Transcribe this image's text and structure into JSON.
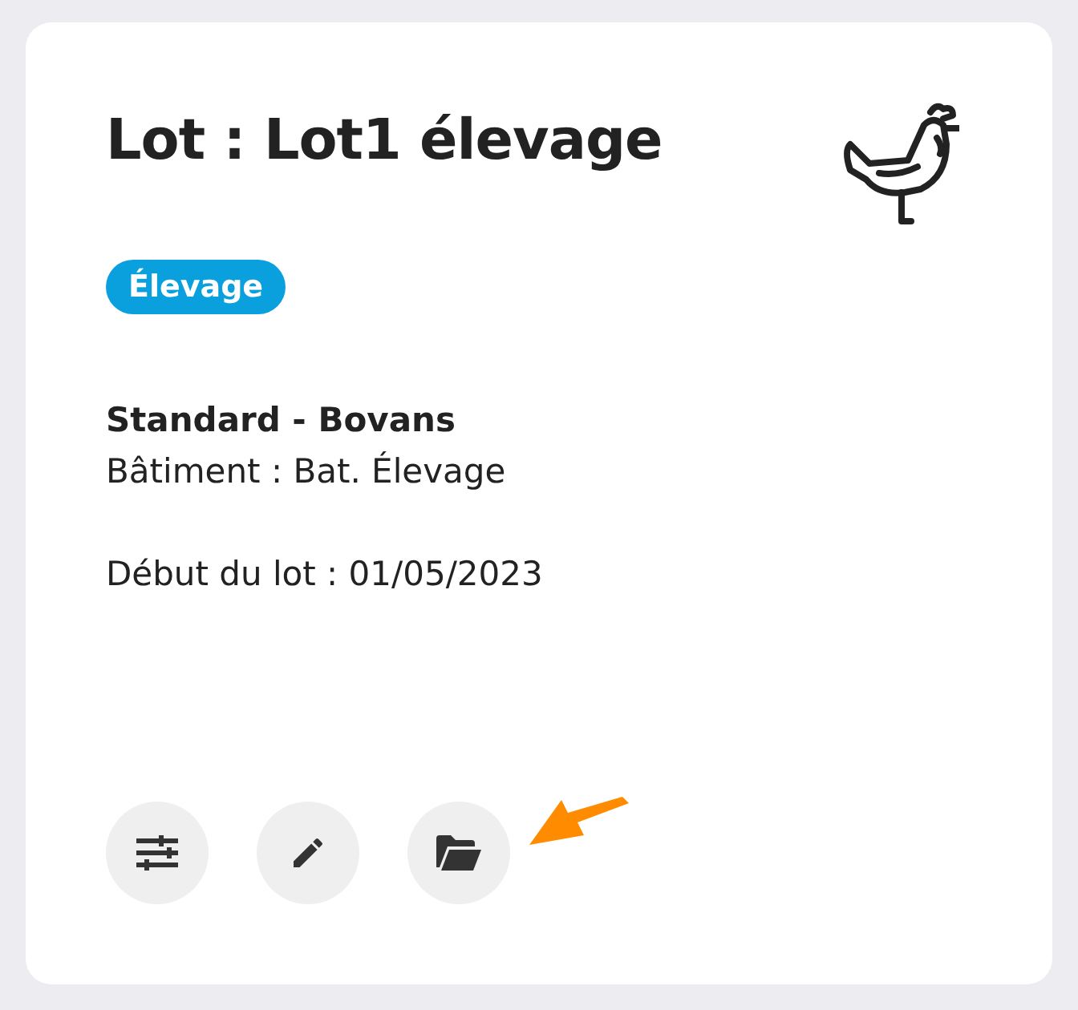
{
  "card": {
    "title": "Lot : Lot1 élevage",
    "badge": "Élevage",
    "breed": "Standard - Bovans",
    "building": "Bâtiment : Bat. Élevage",
    "start": "Début du lot : 01/05/2023",
    "actions": [
      {
        "kind": "settings"
      },
      {
        "kind": "edit"
      },
      {
        "kind": "folder"
      }
    ]
  }
}
